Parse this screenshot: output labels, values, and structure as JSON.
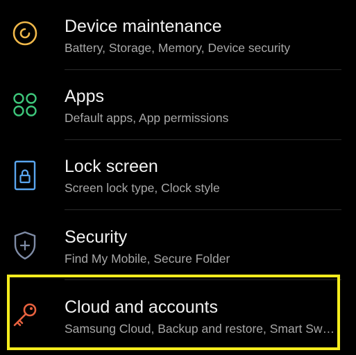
{
  "settings": {
    "items": [
      {
        "title": "Device maintenance",
        "subtitle": "Battery, Storage, Memory, Device security",
        "icon": "device-maintenance-icon",
        "icon_color": "#f0b84a"
      },
      {
        "title": "Apps",
        "subtitle": "Default apps, App permissions",
        "icon": "apps-grid-icon",
        "icon_color": "#3ec77b"
      },
      {
        "title": "Lock screen",
        "subtitle": "Screen lock type, Clock style",
        "icon": "lock-icon",
        "icon_color": "#5aa6f0"
      },
      {
        "title": "Security",
        "subtitle": "Find My Mobile, Secure Folder",
        "icon": "shield-icon",
        "icon_color": "#7f8ca6"
      },
      {
        "title": "Cloud and accounts",
        "subtitle": "Samsung Cloud, Backup and restore, Smart Switch",
        "icon": "key-icon",
        "icon_color": "#e8623f"
      }
    ]
  },
  "highlight": {
    "color": "#f4ec1e",
    "target": "Cloud and accounts"
  }
}
